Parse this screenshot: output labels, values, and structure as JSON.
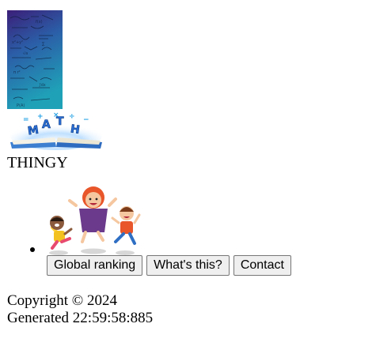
{
  "header": {
    "site_name": "THINGY",
    "logo_text": "MATH"
  },
  "nav": {
    "buttons": [
      {
        "label": "Global ranking"
      },
      {
        "label": "What's this?"
      },
      {
        "label": "Contact"
      }
    ]
  },
  "footer": {
    "copyright": "Copyright © 2024",
    "generated": "Generated 22:59:58:885"
  },
  "colors": {
    "hero_gradient_top": "#3b1e78",
    "hero_gradient_bottom": "#1fa2b8",
    "logo_blue": "#2b6fd6",
    "button_bg": "#efefef",
    "button_border": "#767676"
  }
}
